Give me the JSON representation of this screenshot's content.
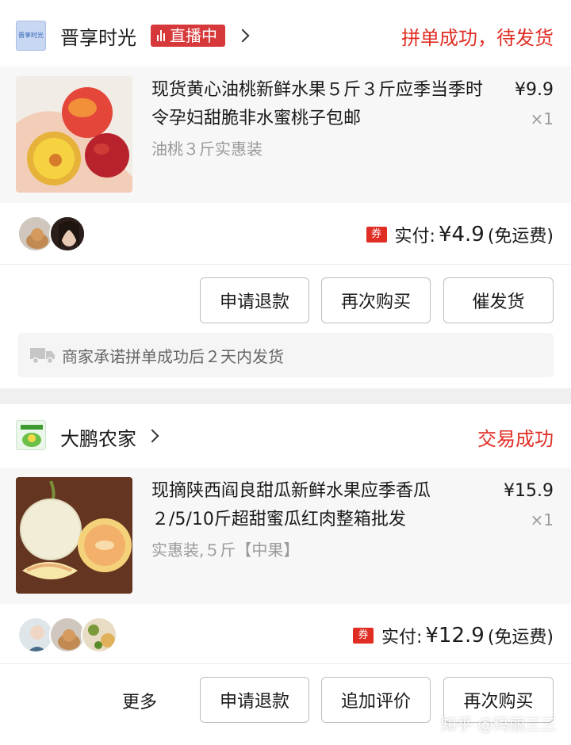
{
  "orders": [
    {
      "shop_name": "晋享时光",
      "shop_logo_text": "晋享时光",
      "live_badge": "直播中",
      "status": "拼单成功，待发货",
      "product_title": "现货黄心油桃新鲜水果５斤３斤应季当季时令孕妇甜脆非水蜜桃子包邮",
      "price": "¥9.9",
      "quantity": "×1",
      "spec": "油桃３斤实惠装",
      "coupon_label": "券",
      "paid_prefix": "实付:",
      "paid_amount": "¥4.9",
      "shipping_note": "(免运费)",
      "buttons": [
        "申请退款",
        "再次购买",
        "催发货"
      ],
      "promise": "商家承诺拼单成功后２天内发货"
    },
    {
      "shop_name": "大鹏农家",
      "status": "交易成功",
      "product_title": "现摘陕西阎良甜瓜新鲜水果应季香瓜２/5/10斤超甜蜜瓜红肉整箱批发",
      "price": "¥15.9",
      "quantity": "×1",
      "spec": "实惠装,５斤【中果】",
      "coupon_label": "券",
      "paid_prefix": "实付:",
      "paid_amount": "¥12.9",
      "shipping_note": "(免运费)",
      "more_label": "更多",
      "buttons": [
        "申请退款",
        "追加评价",
        "再次购买"
      ]
    }
  ],
  "watermark": "知乎 @玛丽三三",
  "colors": {
    "accent_red": "#e02e24",
    "live_red": "#d7393b"
  }
}
